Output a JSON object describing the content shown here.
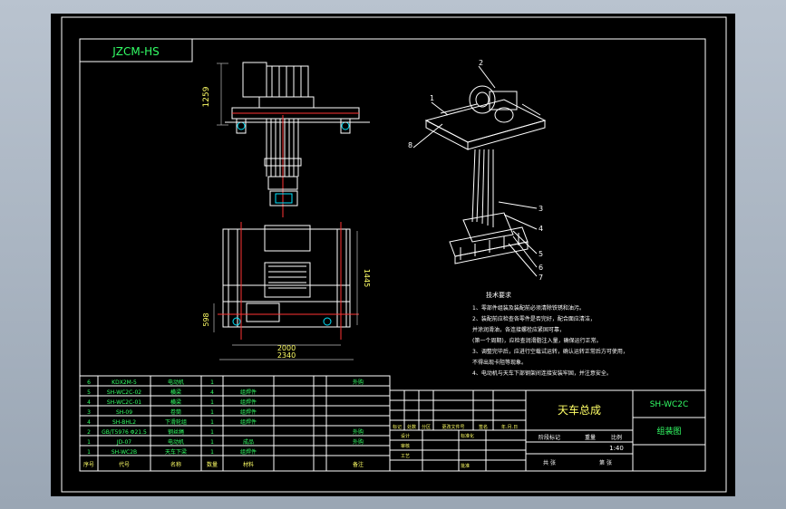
{
  "drawing": {
    "code_box": "JZCM-HS",
    "dims": {
      "height_top": "1259",
      "width_inner": "2000",
      "width_outer": "2340",
      "depth_right": "1445",
      "depth_left": "598"
    },
    "callouts": [
      "1",
      "2",
      "3",
      "4",
      "5",
      "6",
      "7",
      "8"
    ],
    "notes_title": "技术要求",
    "notes": [
      "1、零部件组装及装配前必须清除铁锈和油污。",
      "2、装配前应检查各零件是否完好，配合面应清洁，",
      "   并涂润滑油，各连接螺栓应紧固可靠，",
      "   (第一个周期)，应检查润滑脂注入量，确保运行正常。",
      "3、调整完毕后，应进行空载试运转，确认运转正常后方可使用，",
      "   不得出现卡阻等现象。",
      "4、电动机与天车下部钢架间连接安装牢固，并注意安全。"
    ]
  },
  "bom": {
    "header": {
      "no": "序号",
      "code": "代号",
      "name": "名称",
      "qty": "数量",
      "material": "材料",
      "weight": "",
      "remark": "备注"
    },
    "rows": [
      {
        "no": "6",
        "code": "KDX2M-5",
        "name": "电动机",
        "qty": "1",
        "material": "",
        "remark": "外购"
      },
      {
        "no": "5",
        "code": "SH-WC2C-02",
        "name": "横梁",
        "qty": "4",
        "material": "组焊件",
        "remark": ""
      },
      {
        "no": "4",
        "code": "SH-WC2C-01",
        "name": "横梁",
        "qty": "1",
        "material": "组焊件",
        "remark": ""
      },
      {
        "no": "3",
        "code": "SH-09",
        "name": "卷筒",
        "qty": "1",
        "material": "组焊件",
        "remark": ""
      },
      {
        "no": "4",
        "code": "SH-BHL2",
        "name": "下滑轮组",
        "qty": "1",
        "material": "组焊件",
        "remark": ""
      },
      {
        "no": "2",
        "code": "GB/T5976 Φ21.5",
        "name": "钢丝绳",
        "qty": "1",
        "material": "",
        "remark": "外购"
      },
      {
        "no": "1",
        "code": "JD-07",
        "name": "电动机",
        "qty": "1",
        "material": "成品",
        "remark": "外购"
      },
      {
        "no": "1",
        "code": "SH-WC2B",
        "name": "天车下梁",
        "qty": "1",
        "material": "组焊件",
        "remark": ""
      }
    ]
  },
  "title_block": {
    "title": "天车总成",
    "drawing_no": "SH-WC2C",
    "sheet_type": "组装图",
    "scale": "1:40",
    "labels": [
      "标记",
      "处数",
      "分区",
      "更改文件号",
      "签名",
      "年.月.日",
      "设计",
      "标准化",
      "审核",
      "工艺",
      "批准"
    ],
    "stage_labels": [
      "阶段标记",
      "重量",
      "比例"
    ],
    "sheet_labels": [
      "共 张",
      "第 张"
    ]
  }
}
